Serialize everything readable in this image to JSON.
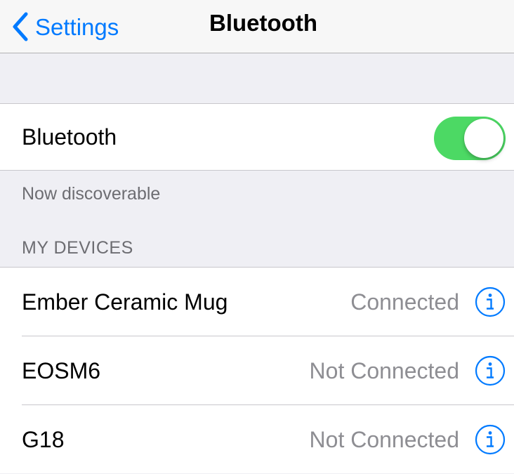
{
  "navbar": {
    "back_label": "Settings",
    "title": "Bluetooth"
  },
  "bluetooth": {
    "label": "Bluetooth",
    "enabled": true,
    "toggle_color": "#4cd964",
    "discoverable_note": "Now discoverable"
  },
  "devices": {
    "header": "MY DEVICES",
    "items": [
      {
        "name": "Ember Ceramic Mug",
        "status": "Connected"
      },
      {
        "name": "EOSM6",
        "status": "Not Connected"
      },
      {
        "name": "G18",
        "status": "Not Connected"
      }
    ]
  },
  "colors": {
    "accent": "#007aff",
    "background": "#efeff4",
    "secondary_text": "#8e8e93"
  },
  "icons": {
    "back": "chevron-left-icon",
    "info": "info-circle-icon"
  }
}
